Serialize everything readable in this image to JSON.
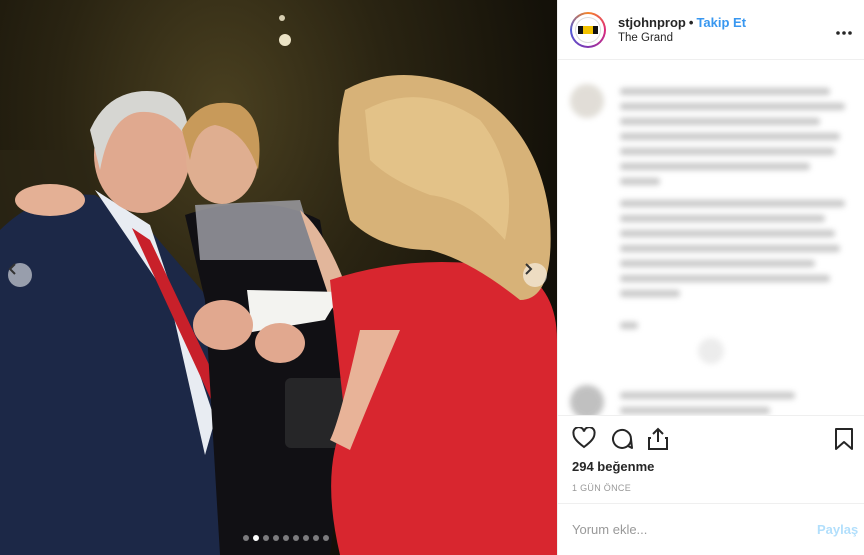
{
  "post": {
    "username": "stjohnprop",
    "separator": "•",
    "follow_label": "Takip Et",
    "location": "The Grand",
    "avatar_text": "ST JOHN",
    "more_icon": "more-options-icon"
  },
  "photo": {
    "carousel_total": 9,
    "carousel_current": 2,
    "icons": [
      "chevron-left-icon",
      "chevron-right-icon"
    ]
  },
  "actions": {
    "icons": [
      "heart-icon",
      "comment-icon",
      "share-icon",
      "bookmark-icon"
    ],
    "likes": "294 beğenme",
    "posted_time": "1 GÜN ÖNCE"
  },
  "comment_box": {
    "placeholder": "Yorum ekle...",
    "post_label": "Paylaş"
  },
  "colors": {
    "accent": "#3897f0",
    "post_disabled": "#b2dffc",
    "border": "#efefef"
  }
}
